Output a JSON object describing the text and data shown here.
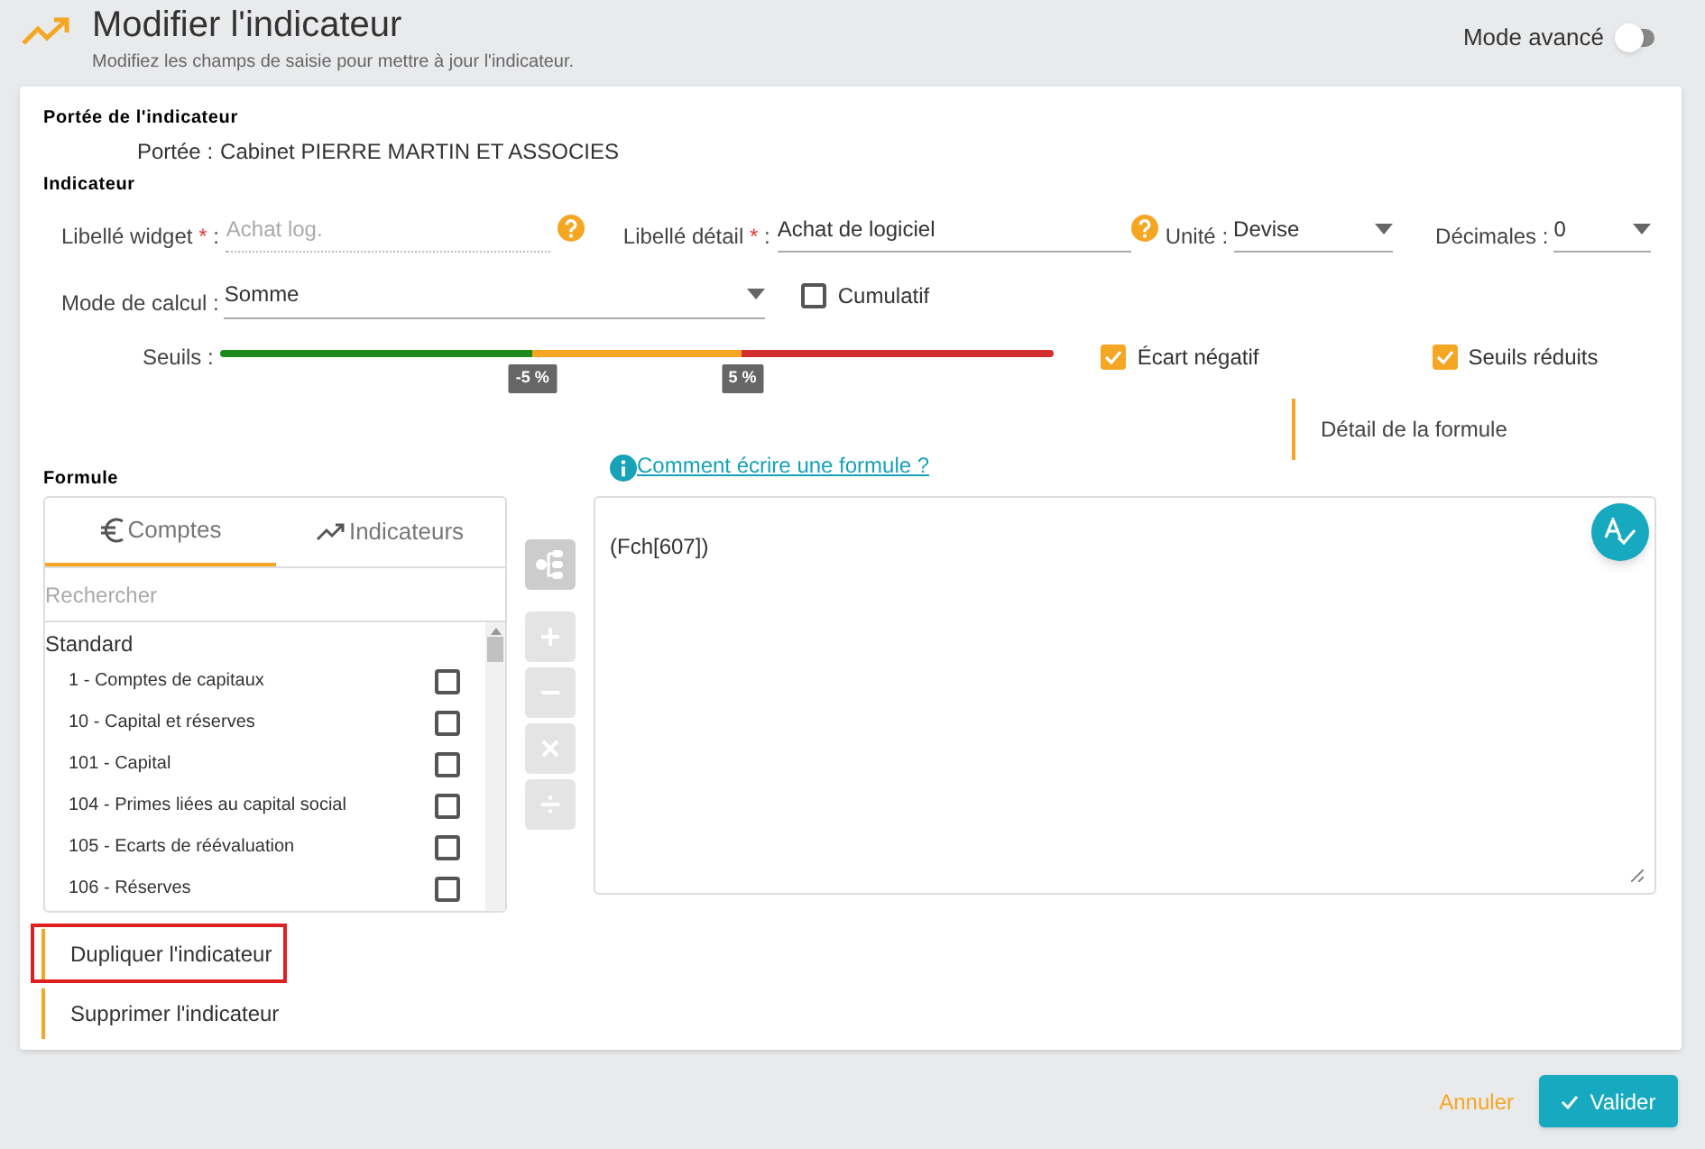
{
  "header": {
    "title": "Modifier l'indicateur",
    "subtitle": "Modifiez les champs de saisie pour mettre à jour l'indicateur.",
    "advanced_mode": {
      "label": "Mode avancé",
      "on": false
    }
  },
  "scope": {
    "heading": "Portée de l'indicateur",
    "label": "Portée :",
    "value": "Cabinet PIERRE MARTIN ET ASSOCIES"
  },
  "indicator": {
    "heading": "Indicateur",
    "widget_label": {
      "label": "Libellé widget",
      "required_mark": "*",
      "colon": ":",
      "placeholder": "Achat log."
    },
    "detail_label": {
      "label": "Libellé détail",
      "required_mark": "*",
      "colon": ":",
      "value": "Achat de logiciel"
    },
    "unit": {
      "label": "Unité :",
      "value": "Devise"
    },
    "decimals": {
      "label": "Décimales :",
      "value": "0"
    },
    "calc_mode": {
      "label": "Mode de calcul :",
      "value": "Somme"
    },
    "cumulative": {
      "label": "Cumulatif",
      "checked": false
    },
    "thresholds": {
      "label": "Seuils :",
      "markers": [
        {
          "label": "-5 %",
          "level": 0.374
        },
        {
          "label": "5 %",
          "level": 0.626
        }
      ]
    },
    "negative_gap": {
      "label": "Écart négatif",
      "checked": true
    },
    "reduced_thresholds": {
      "label": "Seuils réduits",
      "checked": true
    },
    "formula_detail": "Détail de la formule"
  },
  "formula": {
    "heading": "Formule",
    "help_link": "Comment écrire une formule ?",
    "tabs": [
      {
        "label": "Comptes",
        "selected": true,
        "kind": "euro"
      },
      {
        "label": "Indicateurs",
        "selected": false,
        "kind": "trend"
      }
    ],
    "search": {
      "placeholder": "Rechercher"
    },
    "group": "Standard",
    "accounts": [
      {
        "label": "1 - Comptes de capitaux",
        "checked": false
      },
      {
        "label": "10 - Capital et réserves",
        "checked": false
      },
      {
        "label": "101 - Capital",
        "checked": false
      },
      {
        "label": "104 - Primes liées au capital social",
        "checked": false
      },
      {
        "label": "105 - Ecarts de réévaluation",
        "checked": false
      },
      {
        "label": "106 - Réserves",
        "checked": false
      }
    ],
    "operators": [
      {
        "kind": "plus"
      },
      {
        "kind": "minus"
      },
      {
        "kind": "times"
      },
      {
        "kind": "divide"
      }
    ],
    "expression": "(Fch[607])"
  },
  "actions": [
    {
      "label": "Dupliquer l'indicateur",
      "highlighted": true
    },
    {
      "label": "Supprimer l'indicateur",
      "highlighted": false
    }
  ],
  "footer": {
    "cancel": "Annuler",
    "submit": "Valider"
  }
}
